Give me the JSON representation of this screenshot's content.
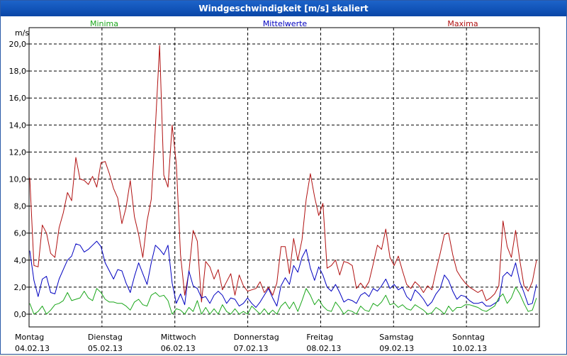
{
  "window": {
    "title": "Windgeschwindigkeit [m/s] skaliert"
  },
  "colors": {
    "minima": "#1aa61a",
    "mittelwerte": "#0000c0",
    "maxima": "#b01010",
    "grid": "#000000"
  },
  "chart_data": {
    "type": "line",
    "title": "Windgeschwindigkeit [m/s] skaliert",
    "ylabel": "m/s",
    "xlabel": "",
    "ylim": [
      0,
      20
    ],
    "yticks": [
      "0,0",
      "2,0",
      "4,0",
      "6,0",
      "8,0",
      "10,0",
      "12,0",
      "14,0",
      "16,0",
      "18,0",
      "20,0"
    ],
    "grid": true,
    "legend_position": "top",
    "days": [
      {
        "day": "Montag",
        "date": "04.02.13"
      },
      {
        "day": "Dienstag",
        "date": "05.02.13"
      },
      {
        "day": "Mittwoch",
        "date": "06.02.13"
      },
      {
        "day": "Donnerstag",
        "date": "07.02.13"
      },
      {
        "day": "Freitag",
        "date": "08.02.13"
      },
      {
        "day": "Samstag",
        "date": "09.02.13"
      },
      {
        "day": "Sonntag",
        "date": "10.02.13"
      }
    ],
    "series": [
      {
        "name": "Minima",
        "values": [
          0.8,
          0.0,
          0.2,
          0.6,
          0.0,
          0.3,
          0.7,
          0.8,
          1.0,
          1.6,
          1.0,
          1.1,
          1.2,
          1.7,
          1.2,
          1.0,
          1.9,
          1.6,
          1.1,
          0.9,
          0.9,
          0.8,
          0.8,
          0.6,
          0.3,
          0.9,
          1.1,
          0.7,
          0.6,
          1.4,
          1.6,
          1.3,
          1.4,
          1.0,
          0.0,
          0.4,
          0.3,
          0.0,
          0.5,
          0.2,
          1.0,
          0.0,
          0.5,
          0.0,
          0.4,
          0.0,
          0.7,
          0.2,
          0.0,
          0.4,
          0.0,
          0.2,
          0.0,
          0.6,
          0.3,
          0.0,
          0.4,
          0.0,
          0.3,
          0.0,
          0.6,
          0.9,
          0.4,
          0.9,
          0.2,
          1.0,
          1.9,
          1.4,
          0.7,
          1.1,
          0.6,
          0.3,
          0.2,
          0.9,
          0.5,
          0.0,
          0.3,
          0.2,
          0.0,
          0.6,
          0.3,
          0.2,
          0.8,
          0.6,
          0.9,
          1.4,
          0.7,
          0.8,
          0.5,
          0.7,
          0.4,
          0.3,
          0.7,
          0.5,
          0.3,
          0.0,
          0.1,
          0.5,
          0.3,
          0.0,
          0.6,
          0.2,
          0.5,
          0.5,
          0.7,
          0.7,
          0.6,
          0.5,
          0.3,
          0.2,
          0.4,
          0.6,
          1.2,
          1.5,
          0.8,
          1.2,
          2.0,
          1.5,
          0.8,
          0.2,
          0.3,
          1.2
        ]
      },
      {
        "name": "Mittelwerte",
        "values": [
          4.7,
          2.5,
          1.3,
          2.6,
          2.8,
          1.6,
          1.5,
          2.6,
          3.3,
          4.0,
          4.3,
          5.2,
          5.1,
          4.6,
          4.8,
          5.1,
          5.4,
          5.0,
          3.8,
          3.2,
          2.6,
          3.3,
          3.2,
          2.3,
          1.6,
          2.8,
          3.8,
          3.0,
          2.2,
          3.8,
          5.1,
          4.8,
          4.4,
          5.1,
          2.3,
          0.8,
          1.5,
          0.7,
          3.2,
          2.1,
          1.9,
          1.2,
          1.3,
          0.8,
          1.4,
          1.7,
          1.4,
          0.8,
          1.2,
          1.1,
          0.6,
          0.8,
          1.2,
          0.8,
          0.5,
          0.9,
          1.4,
          1.9,
          1.2,
          0.6,
          2.1,
          2.7,
          2.2,
          3.6,
          3.1,
          4.2,
          4.8,
          3.4,
          2.5,
          3.5,
          2.9,
          2.0,
          1.7,
          2.2,
          1.6,
          0.9,
          1.1,
          1.0,
          0.8,
          1.4,
          1.6,
          1.3,
          1.9,
          1.7,
          2.1,
          2.6,
          1.9,
          2.2,
          1.8,
          2.0,
          1.3,
          1.0,
          1.8,
          1.5,
          1.1,
          0.6,
          0.9,
          1.5,
          1.9,
          2.9,
          2.5,
          1.7,
          1.1,
          1.4,
          1.3,
          1.0,
          0.8,
          0.8,
          0.9,
          0.6,
          0.6,
          0.8,
          1.0,
          2.8,
          3.1,
          2.8,
          3.8,
          2.4,
          1.6,
          0.7,
          0.8,
          2.2
        ]
      },
      {
        "name": "Maxima",
        "values": [
          10.1,
          3.6,
          3.5,
          6.6,
          6.0,
          4.5,
          4.2,
          6.4,
          7.5,
          9.0,
          8.4,
          11.6,
          10.0,
          9.9,
          9.6,
          10.2,
          9.4,
          11.2,
          11.3,
          10.4,
          9.3,
          8.6,
          6.7,
          7.9,
          9.9,
          7.2,
          5.9,
          4.2,
          6.9,
          8.5,
          13.9,
          19.9,
          10.3,
          9.4,
          14.0,
          11.1,
          4.4,
          1.4,
          3.1,
          6.2,
          5.4,
          0.9,
          3.9,
          3.5,
          2.6,
          3.3,
          1.8,
          2.4,
          3.0,
          1.4,
          2.9,
          2.1,
          1.7,
          1.8,
          1.9,
          2.4,
          1.6,
          2.0,
          1.4,
          2.3,
          5.0,
          5.0,
          3.0,
          5.6,
          4.0,
          5.5,
          8.5,
          10.4,
          8.7,
          7.3,
          8.2,
          3.4,
          3.6,
          4.0,
          2.9,
          3.9,
          3.8,
          3.6,
          1.9,
          2.3,
          1.9,
          2.4,
          3.7,
          5.1,
          4.8,
          6.3,
          4.2,
          3.6,
          4.3,
          3.2,
          2.2,
          1.9,
          2.4,
          2.1,
          1.6,
          2.1,
          1.8,
          3.2,
          4.5,
          5.9,
          6.0,
          4.4,
          3.2,
          2.7,
          2.3,
          2.0,
          1.8,
          1.6,
          1.8,
          1.0,
          1.2,
          1.5,
          2.1,
          6.9,
          5.0,
          4.2,
          6.2,
          4.0,
          2.1,
          1.7,
          2.4,
          4.0
        ]
      }
    ]
  }
}
